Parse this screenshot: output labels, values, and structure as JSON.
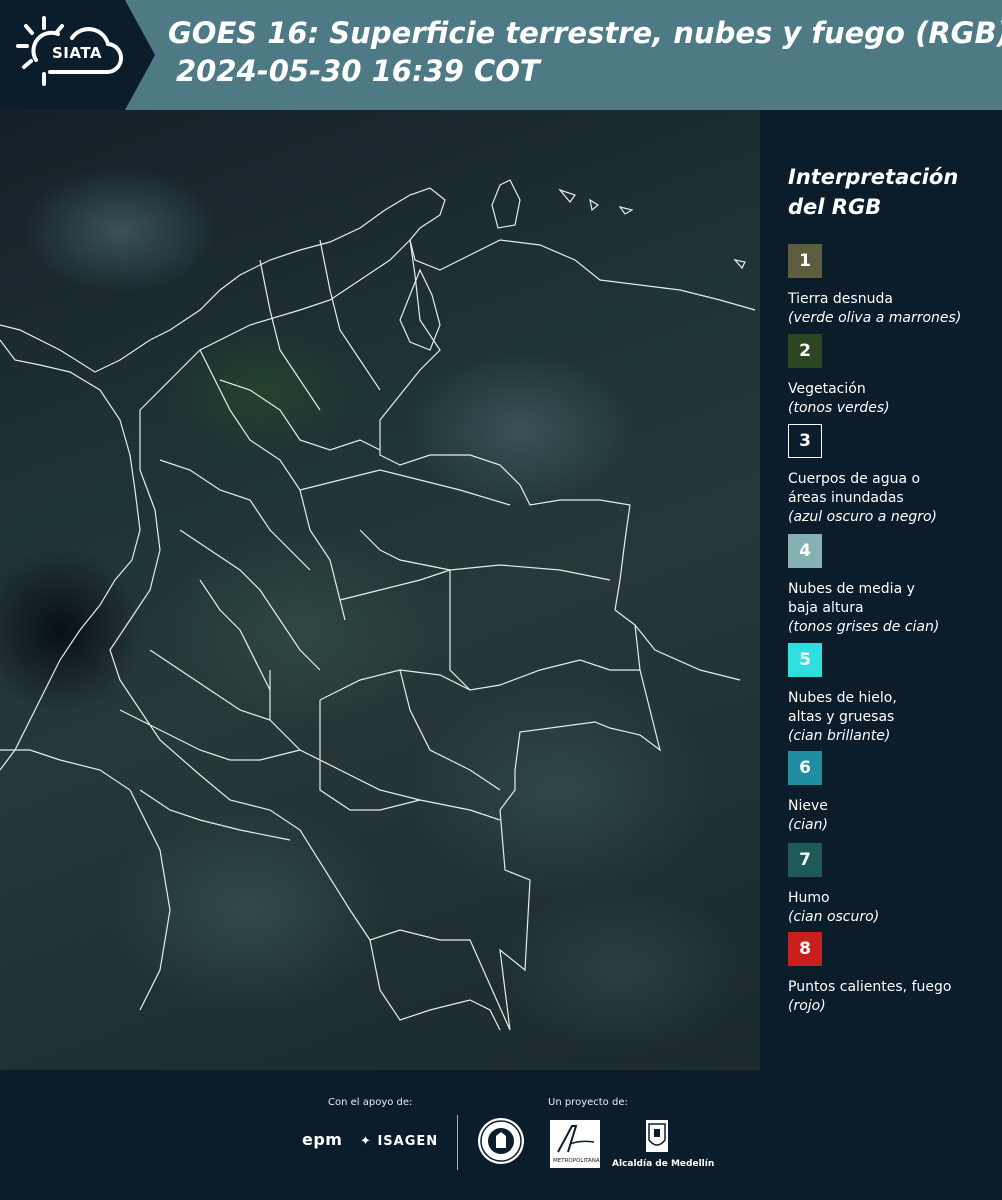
{
  "header": {
    "logo_text": "SIATA",
    "title_line1": "GOES 16: Superficie terrestre, nubes y fuego (RGB)",
    "title_line2": "2024-05-30 16:39 COT"
  },
  "legend": {
    "title": "Interpretación del RGB",
    "items": [
      {
        "number": "1",
        "color": "#5c5c3e",
        "label": "Tierra desnuda",
        "sub": "(verde oliva a marrones)"
      },
      {
        "number": "2",
        "color": "#2d4622",
        "label": "Vegetación",
        "sub": "(tonos verdes)"
      },
      {
        "number": "3",
        "color": "#0b1d2a",
        "label": "Cuerpos de agua o\náreas inundadas",
        "sub": "(azul oscuro a negro)"
      },
      {
        "number": "4",
        "color": "#86b1b2",
        "label": "Nubes de media y\nbaja altura",
        "sub": "(tonos grises de cian)"
      },
      {
        "number": "5",
        "color": "#2fdede",
        "label": "Nubes de hielo,\naltas y gruesas",
        "sub": "(cian brillante)"
      },
      {
        "number": "6",
        "color": "#1e8ea0",
        "label": "Nieve",
        "sub": "(cian)"
      },
      {
        "number": "7",
        "color": "#1f5a5a",
        "label": "Humo",
        "sub": "(cian oscuro)"
      },
      {
        "number": "8",
        "color": "#c81e1e",
        "label": "Puntos calientes, fuego",
        "sub": "(rojo)"
      }
    ]
  },
  "footer": {
    "support_label": "Con el apoyo de:",
    "project_label": "Un proyecto de:",
    "sponsor_1": "epm",
    "sponsor_2": "ISAGEN",
    "partner_1_text": "METROPOLITANA",
    "partner_2": "Alcaldía de Medellín"
  }
}
